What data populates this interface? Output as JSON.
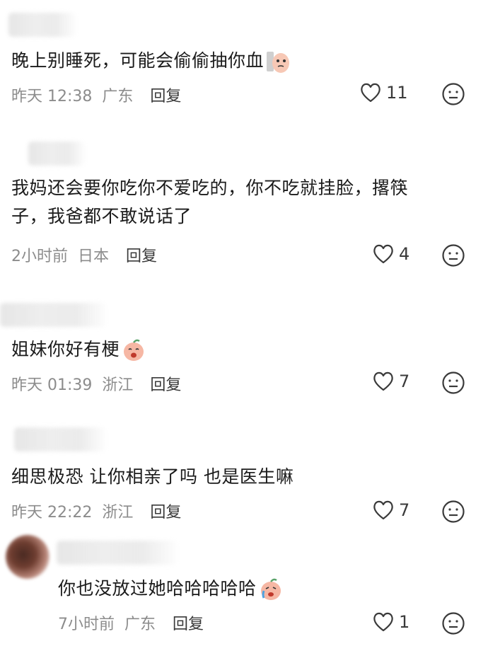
{
  "comments": [
    {
      "text": "晚上别睡死，可能会偷偷抽你血",
      "time": "昨天 12:38",
      "location": "广东",
      "reply": "回复",
      "likes": "11",
      "emoji": "wary-face-sticker"
    },
    {
      "text_line1": "我妈还会要你吃你不爱吃的，你不吃就挂脸，撂筷",
      "text_line2": "子，我爸都不敢说话了",
      "time": "2小时前",
      "location": "日本",
      "reply": "回复",
      "likes": "4"
    },
    {
      "text": "姐妹你好有梗",
      "time": "昨天 01:39",
      "location": "浙江",
      "reply": "回复",
      "likes": "7",
      "emoji": "laughing-peach-sticker"
    },
    {
      "text": "细思极恐 让你相亲了吗 也是医生嘛",
      "time": "昨天 22:22",
      "location": "浙江",
      "reply": "回复",
      "likes": "7"
    },
    {
      "text": "你也没放过她哈哈哈哈哈",
      "time": "7小时前",
      "location": "广东",
      "reply": "回复",
      "likes": "1",
      "emoji": "crying-laugh-peach-sticker"
    }
  ],
  "icons": {
    "like": "heart-outline-icon",
    "dislike": "meh-face-icon"
  },
  "colors": {
    "text": "#1b1b1b",
    "meta": "#8c8c8c",
    "icon": "#3a3a3a"
  }
}
